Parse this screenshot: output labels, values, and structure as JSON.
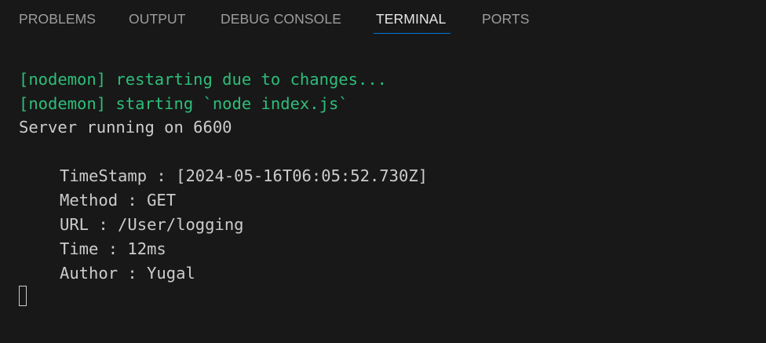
{
  "tabs": [
    {
      "label": "PROBLEMS"
    },
    {
      "label": "OUTPUT"
    },
    {
      "label": "DEBUG CONSOLE"
    },
    {
      "label": "TERMINAL",
      "active": true
    },
    {
      "label": "PORTS"
    }
  ],
  "terminal": {
    "lines": [
      "[nodemon] restarting due to changes...",
      "[nodemon] starting `node index.js`",
      "Server running on 6600",
      "TimeStamp : [2024-05-16T06:05:52.730Z]",
      "Method : GET",
      "URL : /User/logging",
      "Time : 12ms",
      "Author : Yugal"
    ]
  },
  "colors": {
    "background": "#181818",
    "nodemon_text": "#2ebe7a",
    "default_text": "#cccccc",
    "active_tab_underline": "#0078d4"
  }
}
